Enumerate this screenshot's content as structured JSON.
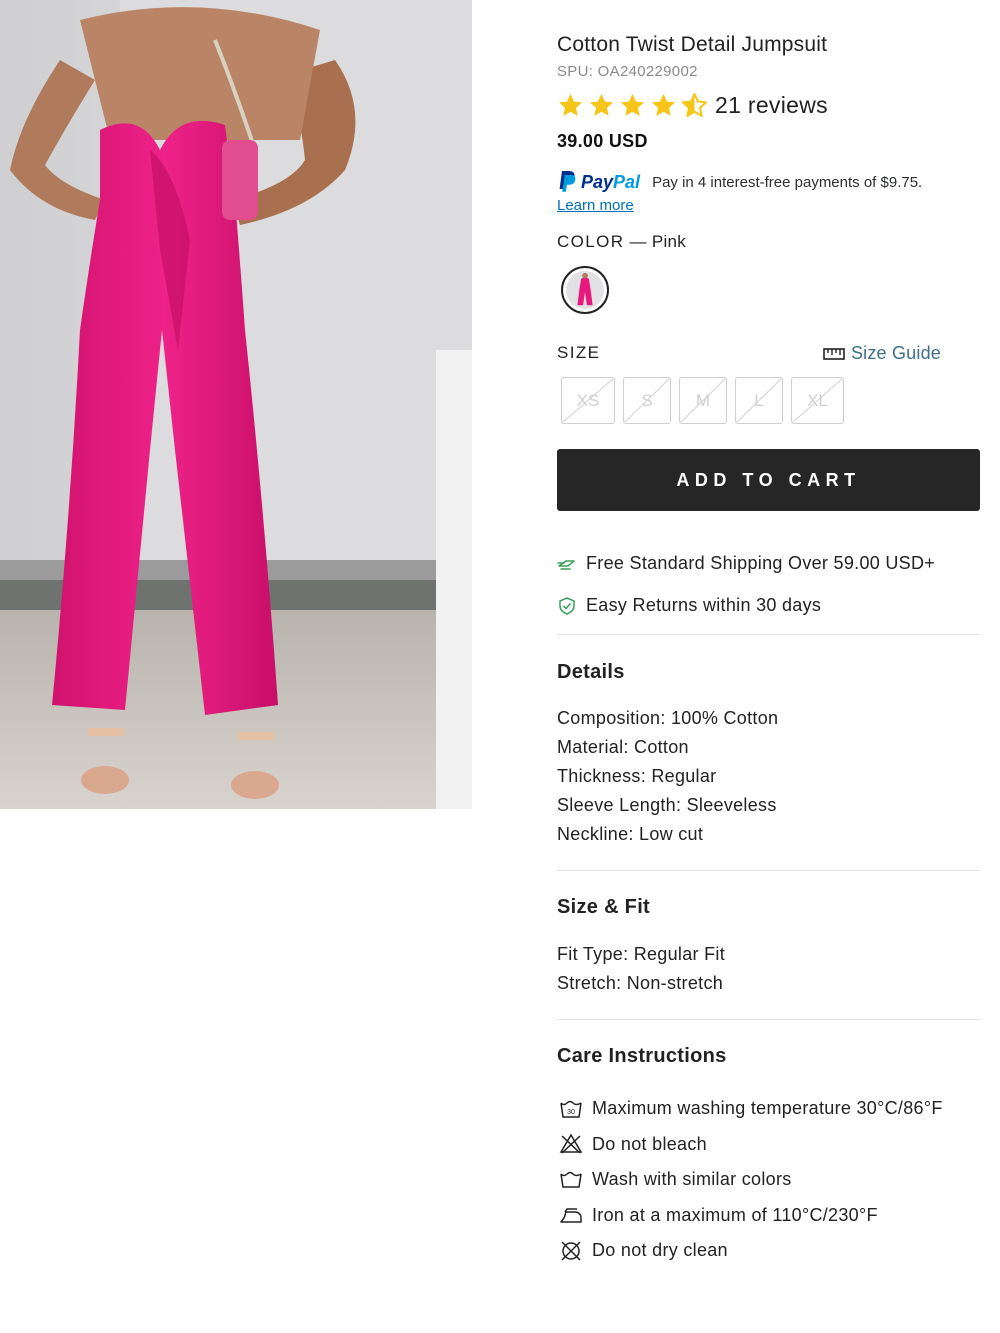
{
  "product": {
    "title": "Cotton Twist Detail Jumpsuit",
    "spu": "SPU: OA240229002",
    "rating": 4.5,
    "reviews": "21 reviews",
    "price": "39.00 USD"
  },
  "paypal": {
    "brand_pay": "Pay",
    "brand_pal": "Pal",
    "message": "Pay in 4 interest-free payments of $9.75.",
    "learn_more": "Learn more"
  },
  "color": {
    "label": "COLOR",
    "separator": " — ",
    "value": "Pink"
  },
  "size": {
    "label": "SIZE",
    "guide_label": "Size Guide",
    "options": [
      "XS",
      "S",
      "M",
      "L",
      "XL"
    ]
  },
  "cart": {
    "button_label": "ADD TO CART"
  },
  "perks": {
    "shipping": "Free Standard Shipping Over 59.00 USD+",
    "returns": "Easy Returns within 30 days"
  },
  "details": {
    "title": "Details",
    "rows": [
      "Composition: 100% Cotton",
      "Material: Cotton",
      "Thickness: Regular",
      "Sleeve Length: Sleeveless",
      "Neckline: Low cut"
    ]
  },
  "size_fit": {
    "title": "Size & Fit",
    "rows": [
      "Fit Type: Regular Fit",
      "Stretch: Non-stretch"
    ]
  },
  "care": {
    "title": "Care Instructions",
    "items": [
      {
        "icon": "wash-30-icon",
        "text": "Maximum washing temperature 30°C/86°F"
      },
      {
        "icon": "no-bleach-icon",
        "text": "Do not bleach"
      },
      {
        "icon": "wash-tub-icon",
        "text": "Wash with similar colors"
      },
      {
        "icon": "iron-icon",
        "text": "Iron at a maximum of 110°C/230°F"
      },
      {
        "icon": "no-dry-clean-icon",
        "text": "Do not dry clean"
      }
    ]
  },
  "colors": {
    "star": "#f5c518",
    "cart_bg": "#262626",
    "accent_link": "#3f6e88",
    "perk_green": "#3aa35b",
    "garment_pink": "#e8187d"
  }
}
